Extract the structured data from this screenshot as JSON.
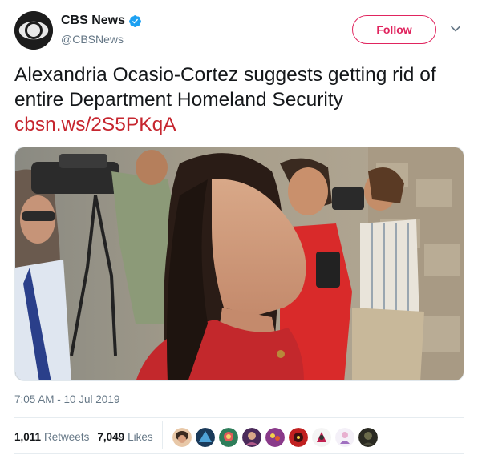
{
  "author": {
    "display_name": "CBS News",
    "handle": "@CBSNews",
    "verified_icon": "verified-badge-icon",
    "avatar_icon": "cbs-eye-logo"
  },
  "follow_label": "Follow",
  "tweet": {
    "text": "Alexandria Ocasio-Cortez suggests getting rid of entire Department Homeland Security",
    "link": "cbsn.ws/2S5PKqA"
  },
  "timestamp": "7:05 AM - 10 Jul 2019",
  "stats": {
    "retweets_count": "1,011",
    "retweets_label": "Retweets",
    "likes_count": "7,049",
    "likes_label": "Likes"
  },
  "colors": {
    "follow_red": "#e0245e",
    "link_red": "#c6262f",
    "verified_blue": "#1da1f2",
    "secondary_text": "#657786"
  }
}
